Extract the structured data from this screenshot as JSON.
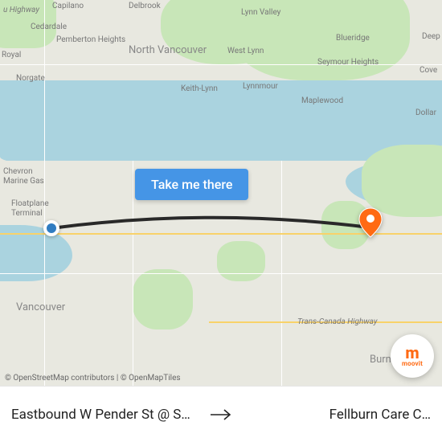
{
  "cta_label": "Take me there",
  "attribution": "© OpenStreetMap contributors | © OpenMapTiles",
  "brand": "moovit",
  "origin_label": "Eastbound W Pender St @ Sey…",
  "destination_label": "Fellburn Care C…",
  "map_labels": {
    "north_vancouver": "North Vancouver",
    "vancouver": "Vancouver",
    "burnaby": "Burnaby",
    "capilano": "Capilano",
    "delbrook": "Delbrook",
    "lynn_valley": "Lynn Valley",
    "cedardale": "Cedardale",
    "pemberton_heights": "Pemberton Heights",
    "west_lynn": "West Lynn",
    "blueridge": "Blueridge",
    "deep": "Deep",
    "royal": "Royal",
    "seymour_heights": "Seymour Heights",
    "cove": "Cove",
    "norgate": "Norgate",
    "keith_lynn": "Keith-Lynn",
    "lynnmour": "Lynnmour",
    "maplewood": "Maplewood",
    "dollar": "Dollar",
    "u_highway": "u Highway",
    "chevron": "Chevron Marine Gas",
    "floatplane": "Floatplane Terminal",
    "trans_canada": "Trans-Canada Highway"
  }
}
